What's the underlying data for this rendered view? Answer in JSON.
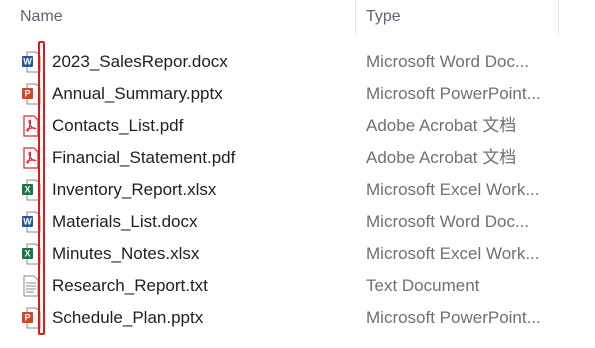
{
  "columns": {
    "name": "Name",
    "type": "Type"
  },
  "files": [
    {
      "name": "2023_SalesRepor.docx",
      "type": "Microsoft Word Doc...",
      "icon": "word-icon"
    },
    {
      "name": "Annual_Summary.pptx",
      "type": "Microsoft PowerPoint...",
      "icon": "powerpoint-icon"
    },
    {
      "name": "Contacts_List.pdf",
      "type": "Adobe Acrobat 文档",
      "icon": "pdf-icon"
    },
    {
      "name": "Financial_Statement.pdf",
      "type": "Adobe Acrobat 文档",
      "icon": "pdf-icon"
    },
    {
      "name": "Inventory_Report.xlsx",
      "type": "Microsoft Excel Work...",
      "icon": "excel-icon"
    },
    {
      "name": "Materials_List.docx",
      "type": "Microsoft Word Doc...",
      "icon": "word-icon"
    },
    {
      "name": "Minutes_Notes.xlsx",
      "type": "Microsoft Excel Work...",
      "icon": "excel-icon"
    },
    {
      "name": "Research_Report.txt",
      "type": "Text Document",
      "icon": "text-file-icon"
    },
    {
      "name": "Schedule_Plan.pptx",
      "type": "Microsoft PowerPoint...",
      "icon": "powerpoint-icon"
    }
  ],
  "colors": {
    "word": "#2b579a",
    "powerpoint": "#d24726",
    "pdf": "#d9272e",
    "excel": "#217346",
    "highlight": "#e01919"
  }
}
